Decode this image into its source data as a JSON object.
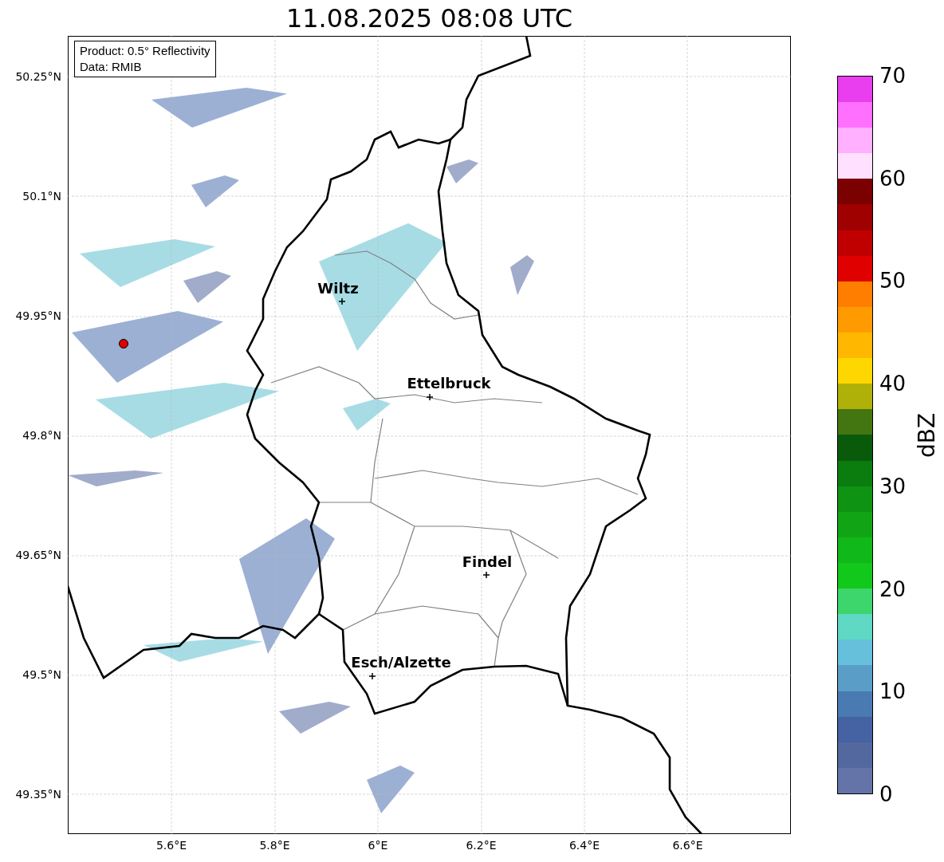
{
  "title": "11.08.2025 08:08 UTC",
  "info_box": [
    "Product: 0.5° Reflectivity",
    "Data: RMIB"
  ],
  "places": [
    {
      "name": "Wiltz"
    },
    {
      "name": "Ettelbruck"
    },
    {
      "name": "Findel"
    },
    {
      "name": "Esch/Alzette"
    }
  ],
  "y_ticks": [
    "50.25°N",
    "50.1°N",
    "49.95°N",
    "49.8°N",
    "49.65°N",
    "49.5°N",
    "49.35°N"
  ],
  "x_ticks": [
    "5.6°E",
    "5.8°E",
    "6°E",
    "6.2°E",
    "6.4°E",
    "6.6°E"
  ],
  "colorbar": {
    "label": "dBZ",
    "ticks": [
      "70",
      "60",
      "50",
      "40",
      "30",
      "20",
      "10",
      "0"
    ],
    "bins": [
      {
        "color": "#6574a8"
      },
      {
        "color": "#5468a0"
      },
      {
        "color": "#4562a3"
      },
      {
        "color": "#4a7ab2"
      },
      {
        "color": "#5a9ec7"
      },
      {
        "color": "#66c0dc"
      },
      {
        "color": "#5fd8c4"
      },
      {
        "color": "#3dd66d"
      },
      {
        "color": "#12c81a"
      },
      {
        "color": "#11b81a"
      },
      {
        "color": "#11a515"
      },
      {
        "color": "#0f9312"
      },
      {
        "color": "#0b7d0f"
      },
      {
        "color": "#0a5a0c"
      },
      {
        "color": "#437510"
      },
      {
        "color": "#afb109"
      },
      {
        "color": "#ffd700"
      },
      {
        "color": "#ffb700"
      },
      {
        "color": "#ff9b00"
      },
      {
        "color": "#ff7e00"
      },
      {
        "color": "#e00000"
      },
      {
        "color": "#c00000"
      },
      {
        "color": "#9f0000"
      },
      {
        "color": "#7b0000"
      },
      {
        "color": "#ffe0ff"
      },
      {
        "color": "#ffb0ff"
      },
      {
        "color": "#ff70ff"
      },
      {
        "color": "#e93ef0"
      }
    ]
  }
}
